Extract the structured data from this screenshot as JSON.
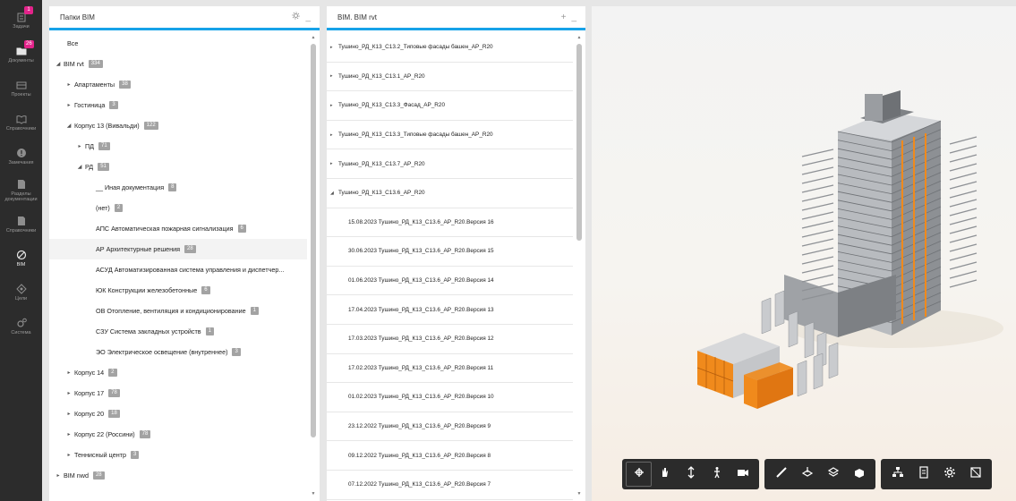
{
  "nav": {
    "items": [
      {
        "label": "Задачи",
        "badge": "1",
        "icon": "tasks-icon"
      },
      {
        "label": "Документы",
        "badge": "26",
        "icon": "folder-icon"
      },
      {
        "label": "Проекты",
        "icon": "projects-icon"
      },
      {
        "label": "Справочники",
        "icon": "book-icon"
      },
      {
        "label": "Замечания",
        "icon": "comment-icon"
      },
      {
        "label": "Разделы\nдокументации",
        "icon": "sections-icon"
      },
      {
        "label": "Справочники",
        "icon": "reference-icon"
      },
      {
        "label": "BIM",
        "icon": "bim-icon",
        "active": true
      },
      {
        "label": "Цели",
        "icon": "target-icon"
      },
      {
        "label": "Система",
        "icon": "system-icon"
      }
    ]
  },
  "folders_panel": {
    "title": "Папки BIM",
    "tree": [
      {
        "label": "Все",
        "level": 0,
        "arrow": ""
      },
      {
        "label": "BIM rvt",
        "badge": "334",
        "level": 0,
        "arrow": "◢"
      },
      {
        "label": "Апартаменты",
        "badge": "38",
        "level": 1,
        "arrow": "▸"
      },
      {
        "label": "Гостиница",
        "badge": "3",
        "level": 1,
        "arrow": "▸"
      },
      {
        "label": "Корпус 13 (Вивальди)",
        "badge": "122",
        "level": 1,
        "arrow": "◢"
      },
      {
        "label": "ПД",
        "badge": "71",
        "level": 2,
        "arrow": "▸"
      },
      {
        "label": "РД",
        "badge": "51",
        "level": 2,
        "arrow": "◢"
      },
      {
        "label": "__ Иная документация",
        "badge": "8",
        "level": 3,
        "arrow": ""
      },
      {
        "label": "(нет)",
        "badge": "2",
        "level": 3,
        "arrow": ""
      },
      {
        "label": "АПС Автоматическая пожарная сигнализация",
        "badge": "6",
        "level": 3,
        "arrow": ""
      },
      {
        "label": "АР Архитектурные решения",
        "badge": "28",
        "level": 3,
        "arrow": "",
        "selected": true
      },
      {
        "label": "АСУД Автоматизированная система управления и диспетчер...",
        "badge": "",
        "level": 3,
        "arrow": ""
      },
      {
        "label": "ЮК Конструкции железобетонные",
        "badge": "6",
        "level": 3,
        "arrow": ""
      },
      {
        "label": "ОВ Отопление, вентиляция и кондиционирование",
        "badge": "1",
        "level": 3,
        "arrow": ""
      },
      {
        "label": "СЗУ Система закладных устройств",
        "badge": "1",
        "level": 3,
        "arrow": ""
      },
      {
        "label": "ЭО Электрическое освещение (внутреннее)",
        "badge": "3",
        "level": 3,
        "arrow": ""
      },
      {
        "label": "Корпус 14",
        "badge": "2",
        "level": 1,
        "arrow": "▸"
      },
      {
        "label": "Корпус 17",
        "badge": "78",
        "level": 1,
        "arrow": "▸"
      },
      {
        "label": "Корпус 20",
        "badge": "18",
        "level": 1,
        "arrow": "▸"
      },
      {
        "label": "Корпус 22 (Россини)",
        "badge": "78",
        "level": 1,
        "arrow": "▸"
      },
      {
        "label": "Теннисный центр",
        "badge": "3",
        "level": 1,
        "arrow": "▸"
      },
      {
        "label": "BIM nwd",
        "badge": "28",
        "level": 0,
        "arrow": "▸"
      }
    ]
  },
  "files_panel": {
    "title": "BIM. BIM rvt",
    "rows": [
      {
        "label": "Тушино_РД_К13_С13.2_Типовые фасады башен_АР_R20",
        "type": "folder",
        "arrow": "▸"
      },
      {
        "label": "Тушино_РД_К13_С13.1_АР_R20",
        "type": "folder",
        "arrow": "▸"
      },
      {
        "label": "Тушино_РД_К13_С13.3_Фасад_АР_R20",
        "type": "folder",
        "arrow": "▸"
      },
      {
        "label": "Тушино_РД_К13_С13.3_Типовые фасады башен_АР_R20",
        "type": "folder",
        "arrow": "▸"
      },
      {
        "label": "Тушино_РД_К13_С13.7_АР_R20",
        "type": "folder",
        "arrow": "▸"
      },
      {
        "label": "Тушино_РД_К13_С13.6_АР_R20",
        "type": "folder",
        "arrow": "◢"
      },
      {
        "label": "15.08.2023 Тушино_РД_К13_С13.6_АР_R20.Версия 16",
        "type": "version",
        "selected": true
      },
      {
        "label": "30.06.2023 Тушино_РД_К13_С13.6_АР_R20.Версия 15",
        "type": "version"
      },
      {
        "label": "01.06.2023 Тушино_РД_К13_С13.6_АР_R20.Версия 14",
        "type": "version"
      },
      {
        "label": "17.04.2023 Тушино_РД_К13_С13.6_АР_R20.Версия 13",
        "type": "version"
      },
      {
        "label": "17.03.2023 Тушино_РД_К13_С13.6_АР_R20.Версия 12",
        "type": "version"
      },
      {
        "label": "17.02.2023 Тушино_РД_К13_С13.6_АР_R20.Версия 11",
        "type": "version"
      },
      {
        "label": "01.02.2023 Тушино_РД_К13_С13.6_АР_R20.Версия 10",
        "type": "version"
      },
      {
        "label": "23.12.2022 Тушино_РД_К13_С13.6_АР_R20.Версия 9",
        "type": "version"
      },
      {
        "label": "09.12.2022 Тушино_РД_К13_С13.6_АР_R20.Версия 8",
        "type": "version"
      },
      {
        "label": "07.12.2022 Тушино_РД_К13_С13.6_АР_R20.Версия 7",
        "type": "version"
      }
    ]
  },
  "viewer": {
    "accent_color": "#f08a1c",
    "toolbar_groups": [
      [
        "orbit-icon",
        "pan-icon",
        "zoom-icon",
        "walk-icon",
        "camera-icon"
      ],
      [
        "measure-icon",
        "section-icon",
        "layers-icon",
        "explode-icon"
      ],
      [
        "tree-icon",
        "properties-icon",
        "settings-icon",
        "fullscreen-icon"
      ]
    ]
  },
  "colors": {
    "accent": "#17a2e8",
    "nav_bg": "#2c2c2c",
    "badge_pink": "#e3238a"
  }
}
